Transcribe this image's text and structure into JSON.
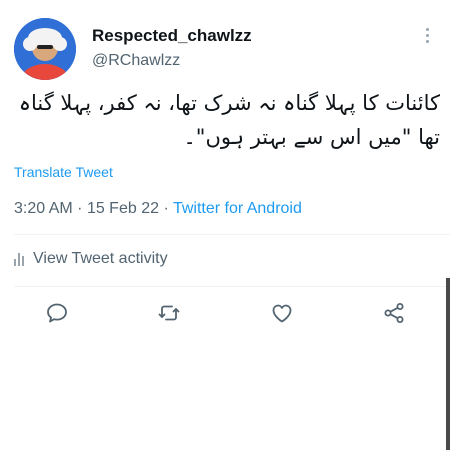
{
  "tweet": {
    "display_name": "Respected_chawlzz",
    "handle": "@RChawlzz",
    "text": "کائنات کا پہلا گناہ نہ شرک تھا، نہ کفر، پہلا گناہ تھا \"میں اس سے بہتر ہوں\"۔",
    "translate_label": "Translate Tweet",
    "time": "3:20 AM",
    "date": "15 Feb 22",
    "separator": "·",
    "source": "Twitter for Android",
    "activity_label": "View Tweet activity"
  },
  "icons": {
    "more": "more-vertical-icon",
    "reply": "reply-icon",
    "retweet": "retweet-icon",
    "like": "heart-icon",
    "share": "share-icon",
    "activity": "bar-chart-icon"
  },
  "colors": {
    "link": "#1d9bf0",
    "muted": "#536471",
    "text": "#0f1419",
    "avatar_bg": "#2f6fd6"
  }
}
